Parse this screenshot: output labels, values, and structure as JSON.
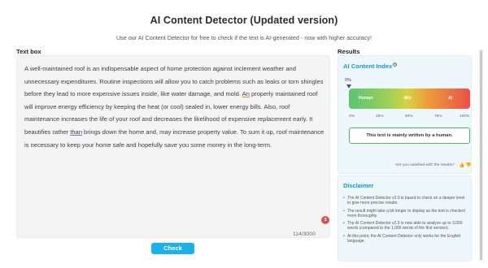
{
  "header": {
    "title": "AI Content Detector (Updated version)",
    "subtitle": "Use our AI Content Detector for free to check if the text is AI-generated - now with higher accuracy!"
  },
  "textbox": {
    "label": "Text box",
    "content_parts": [
      "A well-maintained roof is an indispensable aspect of home protection against inclement weather and unnecessary expenditures. Routine inspections will allow you to catch problems such as leaks or torn shingles before they lead to more expensive issues inside, like water damage, and mold. ",
      "An",
      " properly maintained roof will improve energy efficiency by keeping the heat (or cool) sealed in, lower energy bills. Also, roof maintenance increases the life of your roof and decreases the likelihood of expensive replacement early. It beautifies rather ",
      "than",
      " brings down the home and, may increase property value. To sum it up, roof maintenance is necessary to keep your home safe and hopefully save you some money in the long-term."
    ],
    "grammar_badge": "3",
    "word_count": "114/3000"
  },
  "actions": {
    "check_label": "Check"
  },
  "results": {
    "label": "Results",
    "index_title": "AI Content Index",
    "info_glyph": "?",
    "percentage": "0%",
    "percentage_value": 0,
    "gauge_labels": {
      "human": "Human",
      "mix": "Mix",
      "ai": "AI"
    },
    "ticks": [
      "0%",
      "25%",
      "50%",
      "75%",
      "100%"
    ],
    "verdict": "This text is mainly written by a human.",
    "satisfied_question": "Are you satisfied with the results?",
    "thumb_up": "👍",
    "thumb_down": "👎",
    "colors": {
      "accent": "#1a95c9",
      "human": "#5bc476",
      "mix": "#d8d23f",
      "ai": "#e8504b",
      "button": "#1ab3e8"
    }
  },
  "disclaimer": {
    "title": "Disclaimer",
    "items": [
      "The AI Content Detector v2.0 is based to check on a deeper level to give more precise results.",
      "The result might take a bit longer to display as the text is checked more thoroughly.",
      "The AI Content Detector v2.0 is now able to analyze up to 3,000 words (compared to the 1,000 words of the first version).",
      "At this point, the AI Content Detector only works for the English language."
    ]
  }
}
